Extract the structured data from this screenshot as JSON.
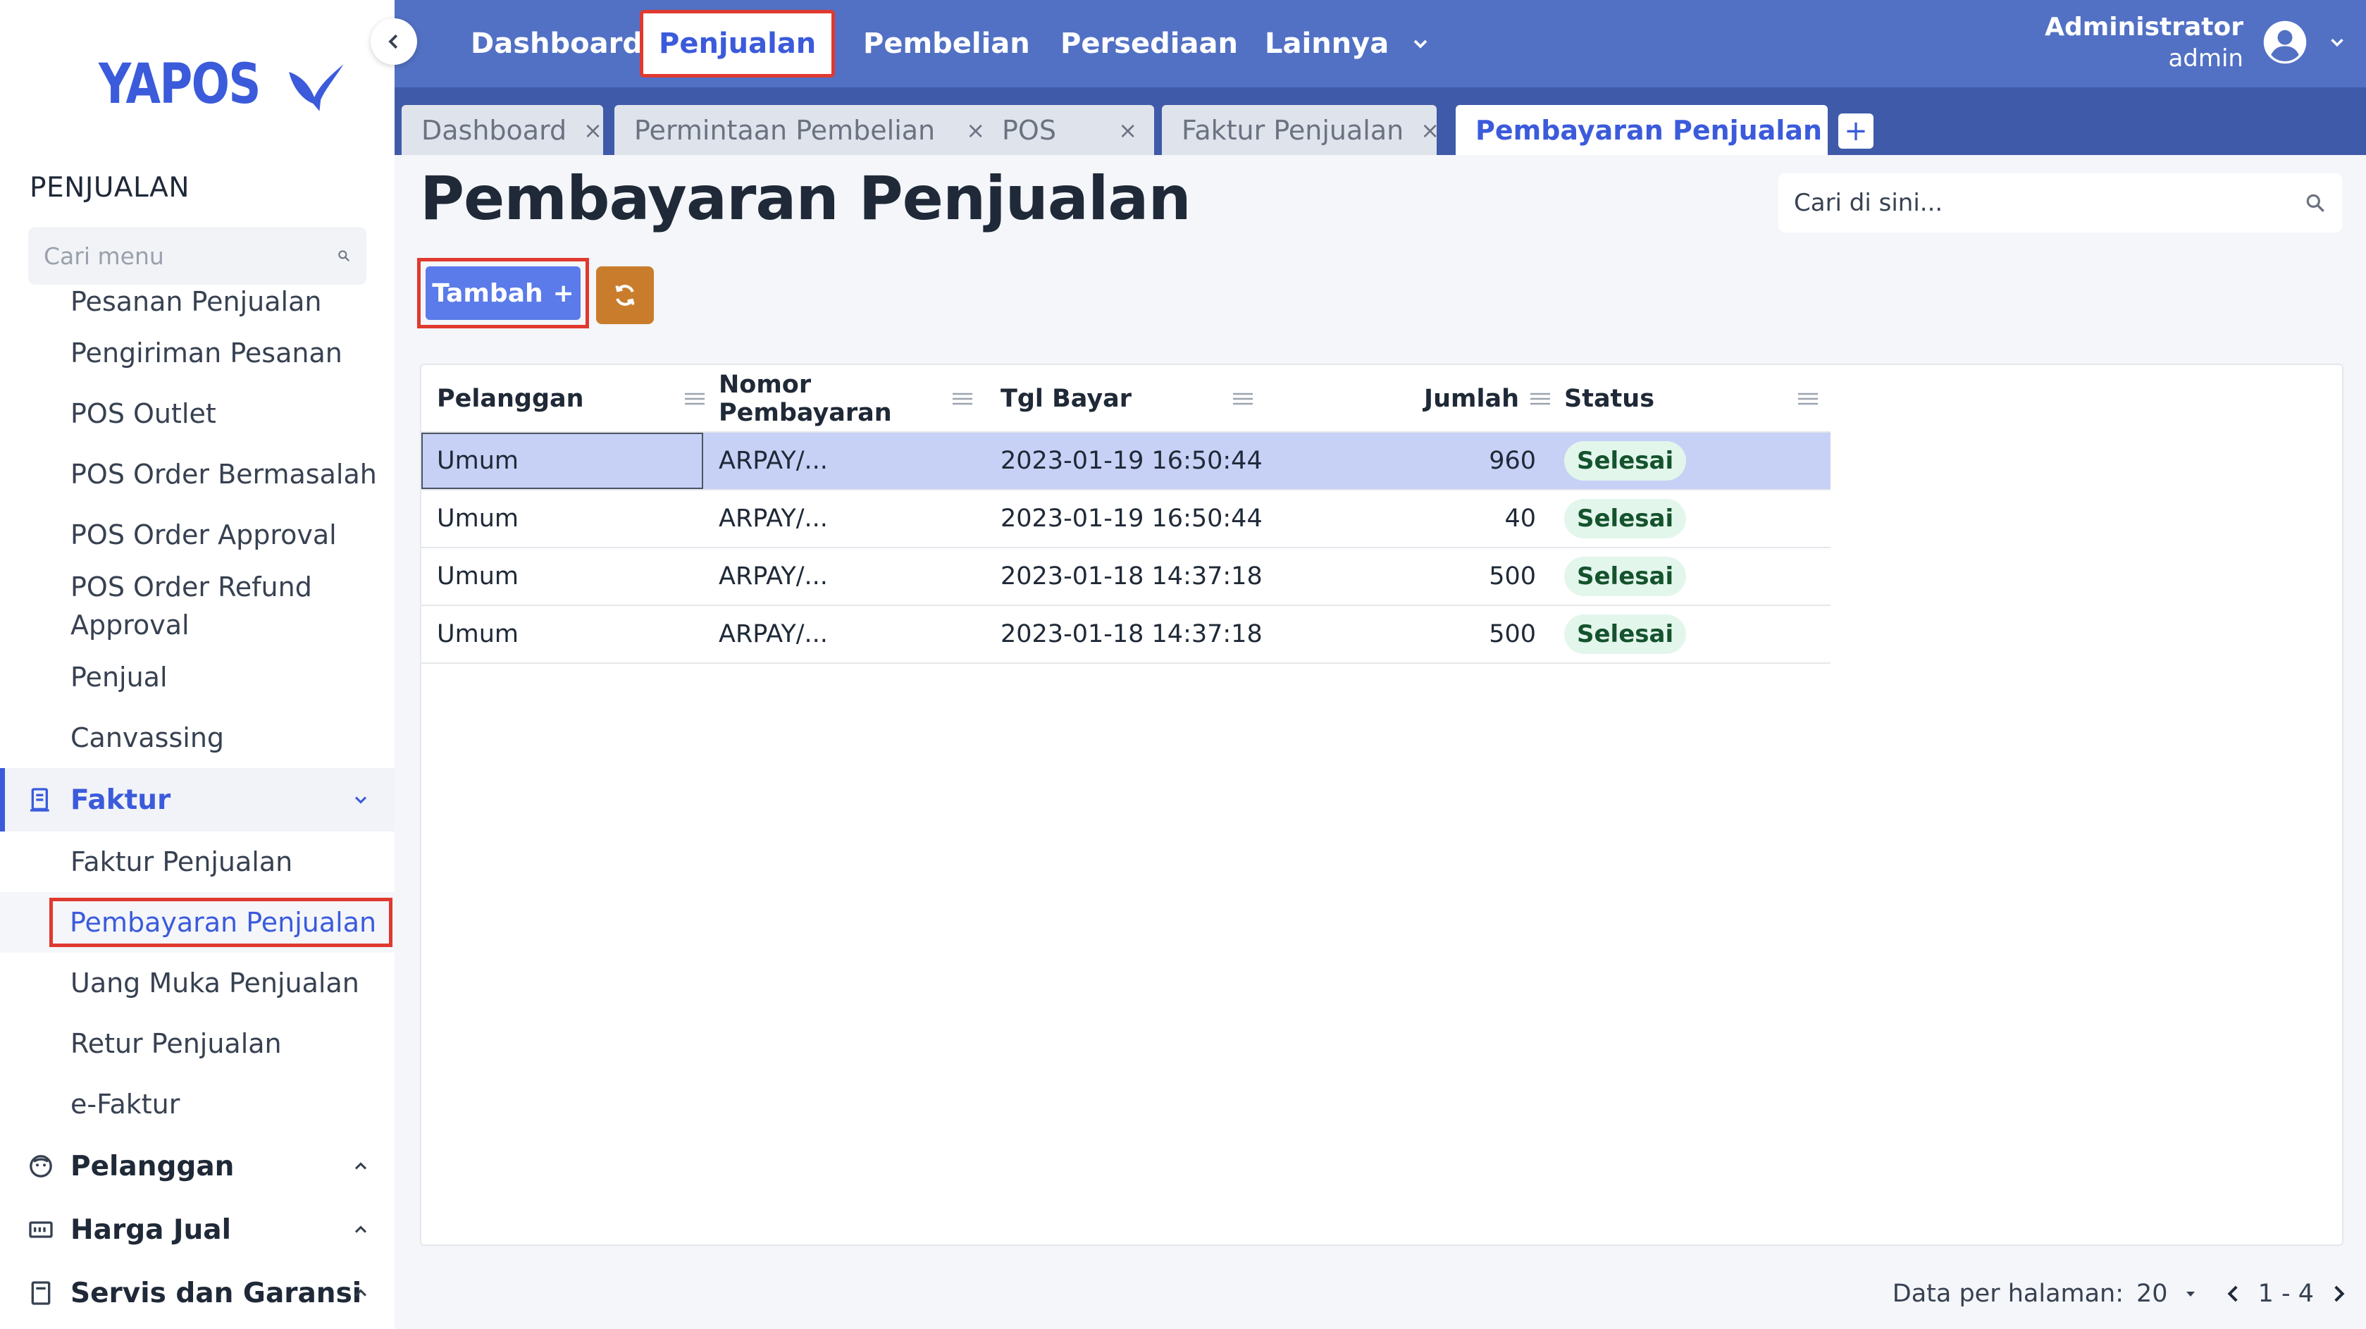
{
  "app": {
    "logo_text": "YAPOS"
  },
  "sidebar": {
    "section_title": "PENJUALAN",
    "search_placeholder": "Cari menu",
    "items_top": [
      "Pesanan Penjualan",
      "Pengiriman Pesanan",
      "POS Outlet",
      "POS Order Bermasalah",
      "POS Order Approval",
      "POS Order Refund Approval",
      "Penjual",
      "Canvassing"
    ],
    "group_faktur": "Faktur",
    "faktur_items": [
      "Faktur Penjualan",
      "Pembayaran Penjualan",
      "Uang Muka Penjualan",
      "Retur Penjualan",
      "e-Faktur"
    ],
    "group_pelanggan": "Pelanggan",
    "group_harga_jual": "Harga Jual",
    "group_servis": "Servis dan Garansi"
  },
  "topnav": {
    "items": [
      "Dashboard",
      "Penjualan",
      "Pembelian",
      "Persediaan",
      "Lainnya"
    ],
    "active": "Penjualan",
    "user_name": "Administrator",
    "user_role": "admin"
  },
  "tabs": [
    {
      "label": "Dashboard",
      "close": "×"
    },
    {
      "label": "Permintaan Pembelian",
      "close": "×"
    },
    {
      "label": "POS",
      "close": "×"
    },
    {
      "label": "Faktur Penjualan",
      "close": "×"
    },
    {
      "label": "Pembayaran Penjualan",
      "close": "×"
    }
  ],
  "tab_add": "+",
  "main": {
    "title": "Pembayaran Penjualan",
    "search_placeholder": "Cari di sini...",
    "add_button": "Tambah",
    "add_button_icon": "+"
  },
  "table": {
    "columns": [
      "Pelanggan",
      "Nomor Pembayaran",
      "Tgl Bayar",
      "Jumlah",
      "Status"
    ],
    "rows": [
      {
        "pelanggan": "Umum",
        "nomor": "ARPAY/...",
        "tgl": "2023-01-19 16:50:44",
        "jumlah": "960",
        "status": "Selesai"
      },
      {
        "pelanggan": "Umum",
        "nomor": "ARPAY/...",
        "tgl": "2023-01-19 16:50:44",
        "jumlah": "40",
        "status": "Selesai"
      },
      {
        "pelanggan": "Umum",
        "nomor": "ARPAY/...",
        "tgl": "2023-01-18 14:37:18",
        "jumlah": "500",
        "status": "Selesai"
      },
      {
        "pelanggan": "Umum",
        "nomor": "ARPAY/...",
        "tgl": "2023-01-18 14:37:18",
        "jumlah": "500",
        "status": "Selesai"
      }
    ]
  },
  "pagination": {
    "per_page_label": "Data per halaman:",
    "per_page_value": "20",
    "range": "1 - 4"
  },
  "colors": {
    "brand": "#3b5bdb",
    "topnav": "#5271c4",
    "tabsbar": "#3f5aa8",
    "highlight": "#e0392f",
    "add_button": "#5b7bea",
    "refresh_button": "#c97d2c",
    "selected_row": "#c7d0f5",
    "status_badge": "#e3f6ec"
  }
}
